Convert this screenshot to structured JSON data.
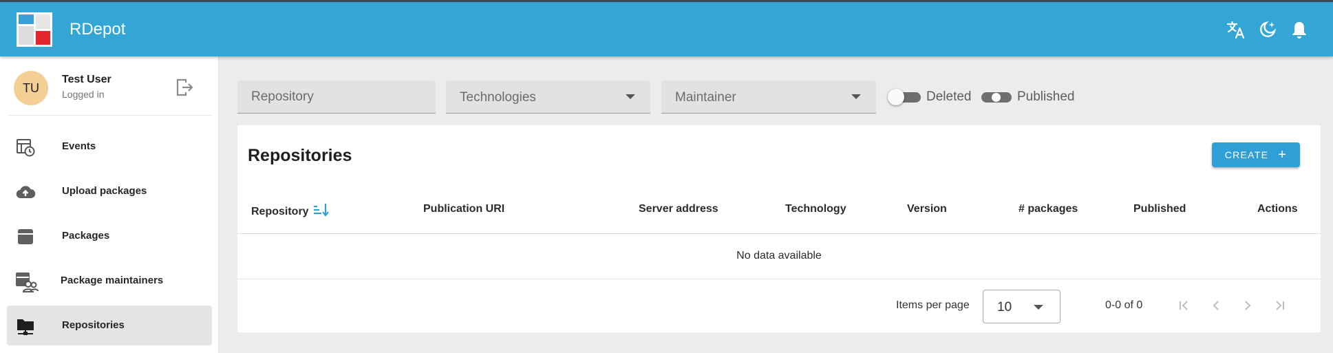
{
  "app": {
    "title": "RDepot"
  },
  "appbar": {
    "icons": [
      "translate-icon",
      "theme-toggle-icon",
      "bell-icon"
    ]
  },
  "user": {
    "initials": "TU",
    "name": "Test User",
    "status": "Logged in"
  },
  "sidebar": {
    "items": [
      {
        "label": "Events",
        "icon": "events-icon"
      },
      {
        "label": "Upload packages",
        "icon": "cloud-upload-icon"
      },
      {
        "label": "Packages",
        "icon": "package-icon"
      },
      {
        "label": "Package maintainers",
        "icon": "maintainers-icon"
      },
      {
        "label": "Repositories",
        "icon": "folder-network-icon",
        "active": true
      }
    ]
  },
  "filters": {
    "repository_placeholder": "Repository",
    "technologies_placeholder": "Technologies",
    "maintainer_placeholder": "Maintainer",
    "deleted_label": "Deleted",
    "deleted_on": false,
    "published_label": "Published",
    "published_state": "indeterminate"
  },
  "card": {
    "title": "Repositories",
    "create_label": "CREATE",
    "columns": [
      "Repository",
      "Publication URI",
      "Server address",
      "Technology",
      "Version",
      "# packages",
      "Published",
      "Actions"
    ],
    "sorted_column": "Repository",
    "empty_text": "No data available"
  },
  "pagination": {
    "items_per_page_label": "Items per page",
    "items_per_page": "10",
    "range": "0-0 of 0"
  },
  "colors": {
    "appbar": "#34a6d6",
    "accent": "#2f9fd5",
    "logo_red": "#e3262c",
    "logo_blue": "#3aa0d8"
  }
}
